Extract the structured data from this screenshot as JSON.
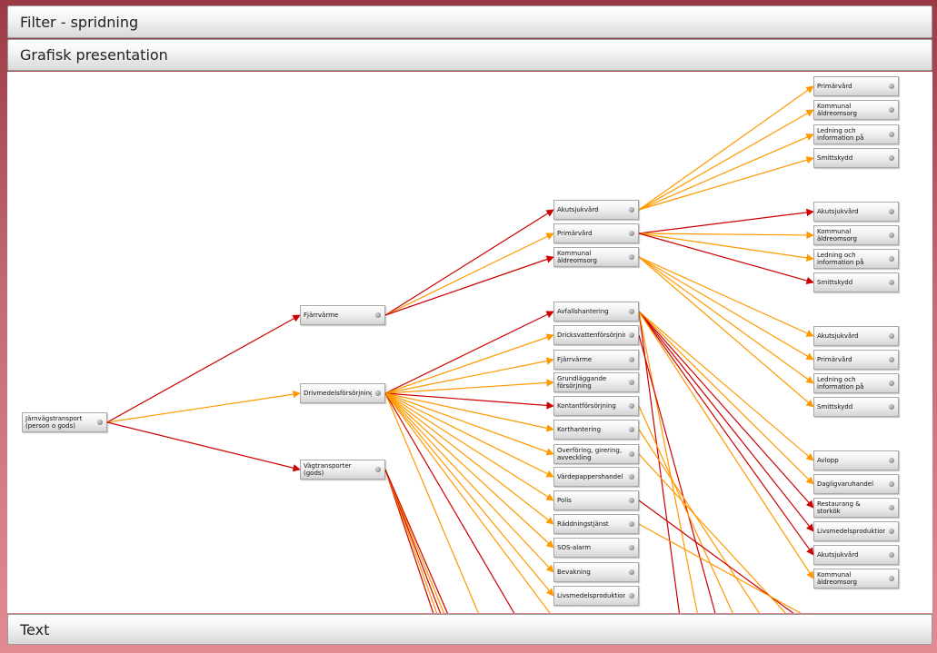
{
  "panels": {
    "filter_title": "Filter - spridning",
    "graph_title": "Grafisk presentation",
    "text_title": "Text"
  },
  "colors": {
    "red_edge": "#cc0000",
    "orange_edge": "#ff9900",
    "background_top": "#9b3a45",
    "background_bottom": "#e38b92"
  },
  "nodes": [
    {
      "id": "root",
      "label": "Järnvägstransport (person o gods)"
    },
    {
      "id": "fjarrvarme",
      "label": "Fjärrvärme"
    },
    {
      "id": "drivmedel",
      "label": "Drivmedelsförsörjning"
    },
    {
      "id": "vagtransporter",
      "label": "Vägtransporter (gods)"
    },
    {
      "id": "akutsjukvard_2",
      "label": "Akutsjukvård"
    },
    {
      "id": "primarvard_2",
      "label": "Primärvård"
    },
    {
      "id": "kommunal_2",
      "label": "Kommunal äldreomsorg"
    },
    {
      "id": "avfall",
      "label": "Avfallshantering"
    },
    {
      "id": "dricksvatten",
      "label": "Dricksvattenförsörjning"
    },
    {
      "id": "fjarrvarme_2",
      "label": "Fjärrvärme"
    },
    {
      "id": "grundlaggande",
      "label": "Grundläggande försörjning"
    },
    {
      "id": "kontant",
      "label": "Kontantförsörjning"
    },
    {
      "id": "korthantering",
      "label": "Korthantering"
    },
    {
      "id": "overforing",
      "label": "Överföring, girering, avveckling"
    },
    {
      "id": "vardepapper",
      "label": "Värdepappershandel"
    },
    {
      "id": "polis",
      "label": "Polis"
    },
    {
      "id": "raddning",
      "label": "Räddningstjänst"
    },
    {
      "id": "sos",
      "label": "SOS-alarm"
    },
    {
      "id": "bevakning",
      "label": "Bevakning"
    },
    {
      "id": "livsmedel_2",
      "label": "Livsmedelsproduktion"
    },
    {
      "id": "a_primarvard",
      "label": "Primärvård"
    },
    {
      "id": "a_kommunal",
      "label": "Kommunal äldreomsorg"
    },
    {
      "id": "a_ledning",
      "label": "Ledning och information på"
    },
    {
      "id": "a_smitt",
      "label": "Smittskydd"
    },
    {
      "id": "b_akut",
      "label": "Akutsjukvård"
    },
    {
      "id": "b_kommunal",
      "label": "Kommunal äldreomsorg"
    },
    {
      "id": "b_ledning",
      "label": "Ledning och information på"
    },
    {
      "id": "b_smitt",
      "label": "Smittskydd"
    },
    {
      "id": "c_akut",
      "label": "Akutsjukvård"
    },
    {
      "id": "c_primar",
      "label": "Primärvård"
    },
    {
      "id": "c_ledning",
      "label": "Ledning och information på"
    },
    {
      "id": "c_smitt",
      "label": "Smittskydd"
    },
    {
      "id": "avlopp",
      "label": "Avlopp"
    },
    {
      "id": "dagligvaru",
      "label": "Dagligvaruhandel"
    },
    {
      "id": "restaurang",
      "label": "Restaurang & storkök"
    },
    {
      "id": "livsmedel_3",
      "label": "Livsmedelsproduktion"
    },
    {
      "id": "d_akut",
      "label": "Akutsjukvård"
    },
    {
      "id": "d_kommunal",
      "label": "Kommunal äldreomsorg"
    }
  ],
  "edges": [
    {
      "from": "root",
      "to": "fjarrvarme",
      "color": "red"
    },
    {
      "from": "root",
      "to": "drivmedel",
      "color": "orange"
    },
    {
      "from": "root",
      "to": "vagtransporter",
      "color": "red"
    },
    {
      "from": "fjarrvarme",
      "to": "akutsjukvard_2",
      "color": "red"
    },
    {
      "from": "fjarrvarme",
      "to": "primarvard_2",
      "color": "orange"
    },
    {
      "from": "fjarrvarme",
      "to": "kommunal_2",
      "color": "red"
    },
    {
      "from": "drivmedel",
      "to": "avfall",
      "color": "red"
    },
    {
      "from": "drivmedel",
      "to": "dricksvatten",
      "color": "orange"
    },
    {
      "from": "drivmedel",
      "to": "fjarrvarme_2",
      "color": "orange"
    },
    {
      "from": "drivmedel",
      "to": "grundlaggande",
      "color": "orange"
    },
    {
      "from": "drivmedel",
      "to": "kontant",
      "color": "red"
    },
    {
      "from": "drivmedel",
      "to": "korthantering",
      "color": "orange"
    },
    {
      "from": "drivmedel",
      "to": "overforing",
      "color": "orange"
    },
    {
      "from": "drivmedel",
      "to": "vardepapper",
      "color": "orange"
    },
    {
      "from": "drivmedel",
      "to": "polis",
      "color": "orange"
    },
    {
      "from": "drivmedel",
      "to": "raddning",
      "color": "orange"
    },
    {
      "from": "drivmedel",
      "to": "sos",
      "color": "orange"
    },
    {
      "from": "drivmedel",
      "to": "bevakning",
      "color": "orange"
    },
    {
      "from": "drivmedel",
      "to": "livsmedel_2",
      "color": "orange"
    },
    {
      "from": "akutsjukvard_2",
      "to": "a_primarvard",
      "color": "orange"
    },
    {
      "from": "akutsjukvard_2",
      "to": "a_kommunal",
      "color": "orange"
    },
    {
      "from": "akutsjukvard_2",
      "to": "a_ledning",
      "color": "orange"
    },
    {
      "from": "akutsjukvard_2",
      "to": "a_smitt",
      "color": "orange"
    },
    {
      "from": "primarvard_2",
      "to": "b_akut",
      "color": "red"
    },
    {
      "from": "primarvard_2",
      "to": "b_kommunal",
      "color": "orange"
    },
    {
      "from": "primarvard_2",
      "to": "b_ledning",
      "color": "orange"
    },
    {
      "from": "primarvard_2",
      "to": "b_smitt",
      "color": "red"
    },
    {
      "from": "kommunal_2",
      "to": "c_akut",
      "color": "orange"
    },
    {
      "from": "kommunal_2",
      "to": "c_primar",
      "color": "orange"
    },
    {
      "from": "kommunal_2",
      "to": "c_ledning",
      "color": "orange"
    },
    {
      "from": "kommunal_2",
      "to": "c_smitt",
      "color": "orange"
    },
    {
      "from": "avfall",
      "to": "avlopp",
      "color": "orange"
    },
    {
      "from": "avfall",
      "to": "dagligvaru",
      "color": "orange"
    },
    {
      "from": "avfall",
      "to": "restaurang",
      "color": "red"
    },
    {
      "from": "avfall",
      "to": "livsmedel_3",
      "color": "red"
    },
    {
      "from": "avfall",
      "to": "d_akut",
      "color": "red"
    },
    {
      "from": "avfall",
      "to": "d_kommunal",
      "color": "orange"
    }
  ]
}
